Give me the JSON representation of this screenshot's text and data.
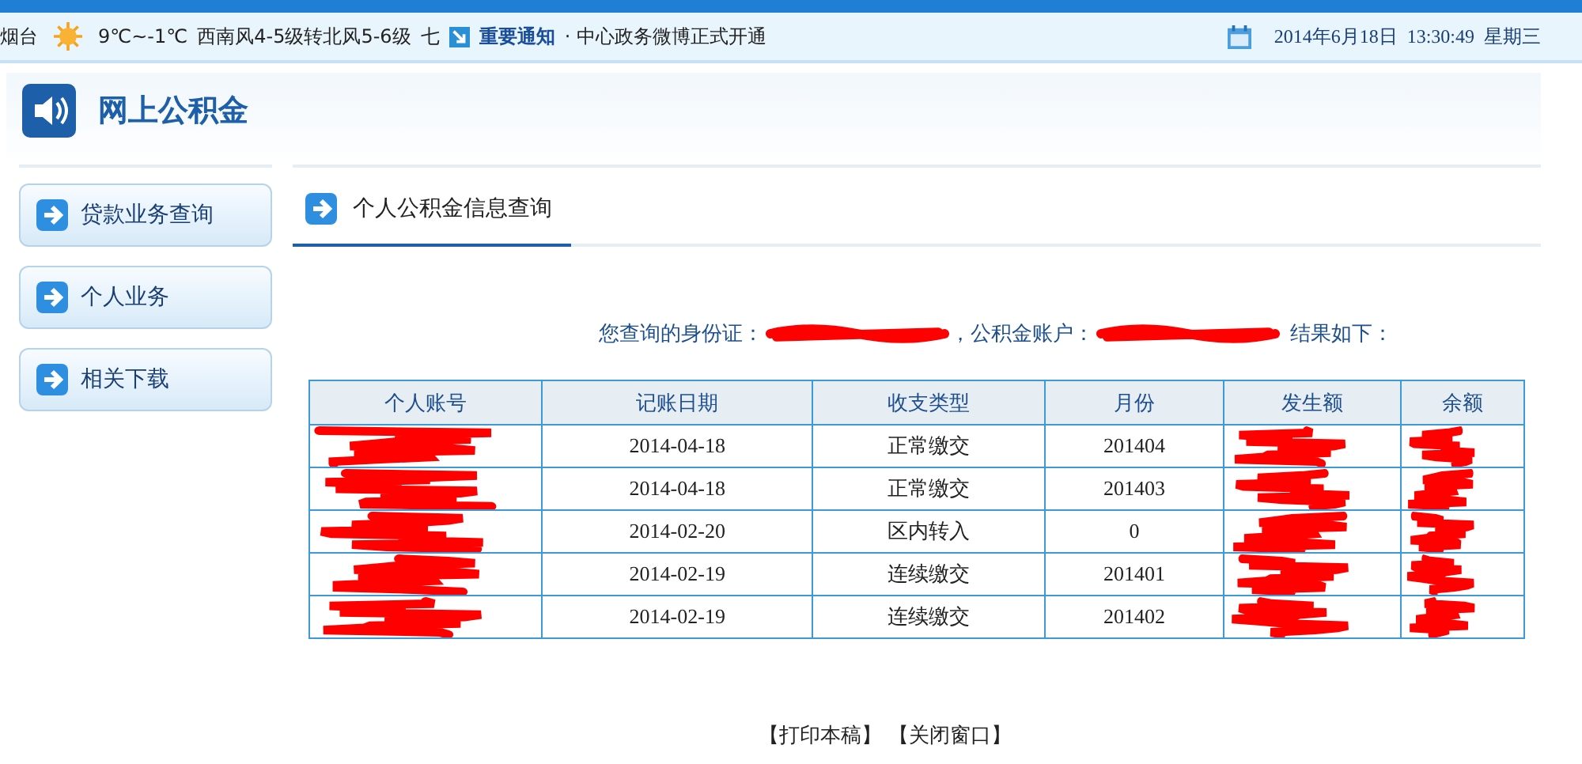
{
  "info_bar": {
    "city": "烟台",
    "temperature": "9℃~-1℃",
    "wind": "西南风4-5级转北风5-6级",
    "wind_extra": "七",
    "notice_label": "重要通知",
    "notice_text": "· 中心政务微博正式开通",
    "date": "2014年6月18日",
    "time": "13:30:49",
    "weekday": "星期三"
  },
  "header": {
    "title": "网上公积金"
  },
  "sidebar": {
    "items": [
      {
        "label": "贷款业务查询"
      },
      {
        "label": "个人业务"
      },
      {
        "label": "相关下载"
      }
    ]
  },
  "tabs": [
    {
      "label": "个人公积金信息查询",
      "selected": true
    }
  ],
  "query": {
    "id_label": "您查询的身份证：",
    "id_redacted": true,
    "account_label": "，公积金账户：",
    "account_redacted": true,
    "suffix": "结果如下："
  },
  "table": {
    "columns": [
      {
        "label": "个人账号",
        "redacted": true
      },
      {
        "label": "记账日期",
        "redacted": false
      },
      {
        "label": "收支类型",
        "redacted": false
      },
      {
        "label": "月份",
        "redacted": false
      },
      {
        "label": "发生额",
        "redacted": true
      },
      {
        "label": "余额",
        "redacted": true
      }
    ],
    "rows": [
      {
        "cells": [
          null,
          "2014-04-18",
          "正常缴交",
          "201404",
          null,
          null
        ]
      },
      {
        "cells": [
          null,
          "2014-04-18",
          "正常缴交",
          "201403",
          null,
          null
        ]
      },
      {
        "cells": [
          null,
          "2014-02-20",
          "区内转入",
          "0",
          null,
          null
        ]
      },
      {
        "cells": [
          null,
          "2014-02-19",
          "连续缴交",
          "201401",
          null,
          null
        ]
      },
      {
        "cells": [
          null,
          "2014-02-19",
          "连续缴交",
          "201402",
          null,
          null
        ]
      }
    ]
  },
  "footer": {
    "links": [
      "【打印本稿】",
      "【关闭窗口】"
    ]
  }
}
